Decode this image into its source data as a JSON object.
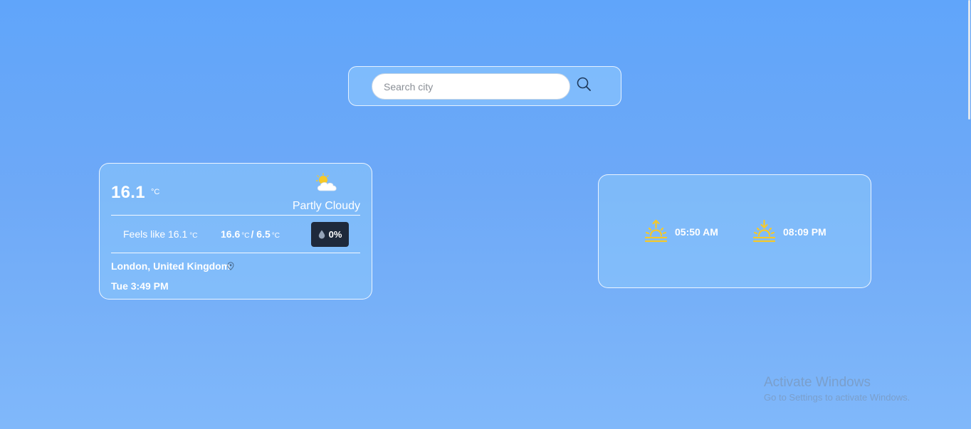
{
  "search": {
    "placeholder": "Search city",
    "value": ""
  },
  "current": {
    "temperature": "16.1",
    "unit": "°C",
    "condition": "Partly Cloudy",
    "condition_icon": "partly-cloudy-icon",
    "feels_like_label": "Feels like 16.1",
    "feels_like_unit": "°C",
    "high": "16.6",
    "low": "6.5",
    "hilo_separator": "/",
    "precipitation": "0%",
    "precipitation_icon": "raindrop-icon",
    "location": "London, United Kingdom",
    "location_icon": "map-pin-icon",
    "datetime": "Tue 3:49 PM"
  },
  "sun": {
    "sunrise": "05:50 AM",
    "sunrise_icon": "sunrise-icon",
    "sunset": "08:09 PM",
    "sunset_icon": "sunset-icon"
  },
  "watermark": {
    "line1": "Activate Windows",
    "line2": "Go to Settings to activate Windows."
  },
  "colors": {
    "background": "#60a5fa",
    "card": "#8cc8fc",
    "precip_badge": "#1e293b",
    "sun_icon": "#f6c928"
  }
}
